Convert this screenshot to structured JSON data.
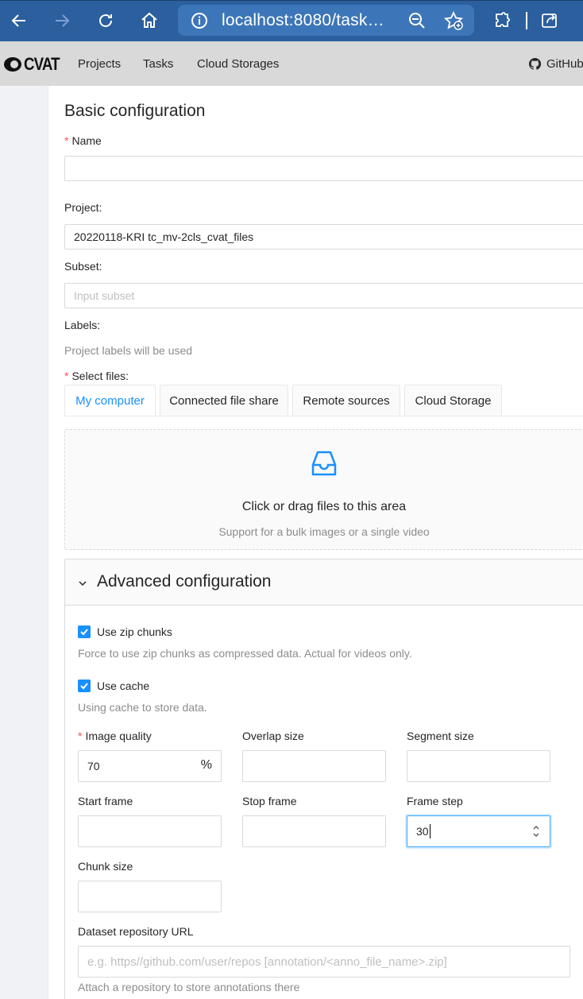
{
  "browser": {
    "url": "localhost:8080/task…"
  },
  "header": {
    "logo_text": "CVAT",
    "menu": [
      "Projects",
      "Tasks",
      "Cloud Storages"
    ],
    "github_label": "GitHub"
  },
  "form": {
    "section_title": "Basic configuration",
    "name_label": "Name",
    "name_value": "",
    "project_label": "Project:",
    "project_value": "20220118-KRI tc_mv-2cls_cvat_files",
    "subset_label": "Subset:",
    "subset_placeholder": "Input subset",
    "labels_label": "Labels:",
    "labels_note": "Project labels will be used",
    "select_files_label": "Select files:",
    "tabs": [
      "My computer",
      "Connected file share",
      "Remote sources",
      "Cloud Storage"
    ],
    "active_tab": "My computer",
    "dropzone_title": "Click or drag files to this area",
    "dropzone_hint": "Support for a bulk images or a single video"
  },
  "advanced": {
    "title": "Advanced configuration",
    "zip_chunks_label": "Use zip chunks",
    "zip_chunks_checked": true,
    "zip_chunks_hint": "Force to use zip chunks as compressed data. Actual for videos only.",
    "cache_label": "Use cache",
    "cache_checked": true,
    "cache_hint": "Using cache to store data.",
    "image_quality_label": "Image quality",
    "image_quality_value": "70",
    "image_quality_suffix": "%",
    "overlap_label": "Overlap size",
    "segment_label": "Segment size",
    "start_frame_label": "Start frame",
    "stop_frame_label": "Stop frame",
    "frame_step_label": "Frame step",
    "frame_step_value": "30",
    "chunk_size_label": "Chunk size",
    "repo_url_label": "Dataset repository URL",
    "repo_url_placeholder": "e.g. https//github.com/user/repos [annotation/<anno_file_name>.zip]",
    "repo_hint": "Attach a repository to store annotations there"
  },
  "colors": {
    "browser_bar": "#2b5f9e",
    "header_bg": "#d9d9d9",
    "accent": "#1890ff",
    "required": "#ff4d4f"
  }
}
